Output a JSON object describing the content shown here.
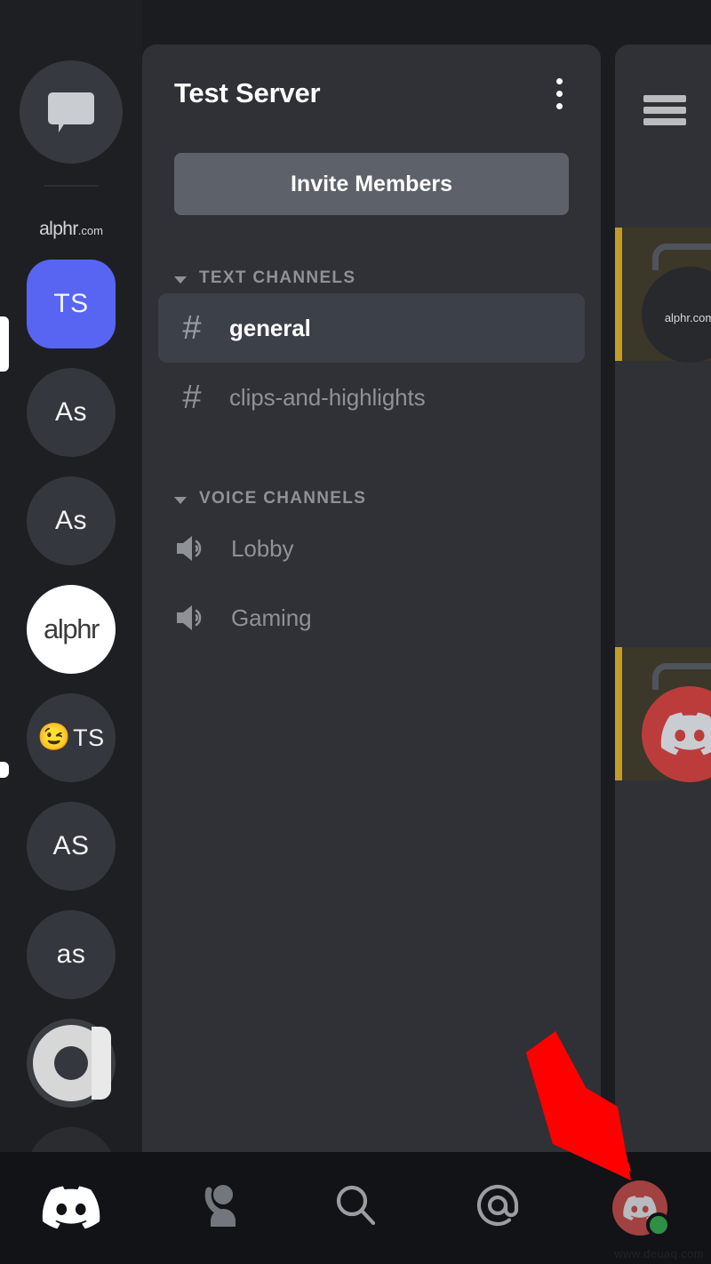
{
  "app": {
    "name": "Discord",
    "platform": "mobile"
  },
  "colors": {
    "brand": "#5865f2",
    "panel_bg": "#2f3136",
    "rail_bg": "#1d1f23",
    "nav_bg": "#121316",
    "channel_active_bg": "#3c4049",
    "invite_button_bg": "#5d6169",
    "mention_border": "#c49b2b",
    "annotation_arrow": "#ff0000",
    "status_online": "#2f8f45",
    "text_muted": "#8e9297",
    "text_primary": "#ffffff"
  },
  "rail": {
    "dm_icon": "chat-bubble-icon",
    "brand_watermark": {
      "text": "alphr",
      "suffix": ".com"
    },
    "servers": [
      {
        "id": "ts-selected",
        "label": "TS",
        "style": "selected",
        "selected": true,
        "unread": false
      },
      {
        "id": "as-1",
        "label": "As",
        "style": "circle",
        "selected": false,
        "unread": false
      },
      {
        "id": "as-2",
        "label": "As",
        "style": "circle",
        "selected": false,
        "unread": false
      },
      {
        "id": "alphr",
        "label": "alphr",
        "style": "white-logo",
        "selected": false,
        "unread": false
      },
      {
        "id": "emoji-ts",
        "label": "TS",
        "emoji": "😉",
        "style": "emoji",
        "selected": false,
        "unread": true
      },
      {
        "id": "as-3",
        "label": "AS",
        "style": "circle",
        "selected": false,
        "unread": false
      },
      {
        "id": "as-4",
        "label": "as",
        "style": "circle",
        "selected": false,
        "unread": false
      },
      {
        "id": "eye-logo",
        "label": "",
        "style": "eye-logo",
        "selected": false,
        "unread": false
      }
    ]
  },
  "panel": {
    "server_name": "Test Server",
    "overflow_menu_icon": "kebab-menu-icon",
    "invite_label": "Invite Members",
    "categories": [
      {
        "id": "text-channels",
        "label": "TEXT CHANNELS",
        "collapsed": false,
        "chevron_icon": "chevron-down-icon",
        "channels": [
          {
            "id": "general",
            "name": "general",
            "type": "text",
            "icon": "hash-icon",
            "active": true
          },
          {
            "id": "clips-and-highlights",
            "name": "clips-and-highlights",
            "type": "text",
            "icon": "hash-icon",
            "active": false
          }
        ]
      },
      {
        "id": "voice-channels",
        "label": "VOICE CHANNELS",
        "collapsed": false,
        "chevron_icon": "chevron-down-icon",
        "channels": [
          {
            "id": "lobby",
            "name": "Lobby",
            "type": "voice",
            "icon": "speaker-icon",
            "active": false
          },
          {
            "id": "gaming",
            "name": "Gaming",
            "type": "voice",
            "icon": "speaker-icon",
            "active": false
          }
        ]
      }
    ]
  },
  "right_panel": {
    "menu_icon": "hamburger-menu-icon",
    "messages": [
      {
        "id": "msg-1",
        "avatar": "alphr-avatar",
        "avatar_text": "alphr",
        "avatar_suffix": ".com",
        "mention": true,
        "reply": true
      },
      {
        "id": "msg-2",
        "avatar": "discord-avatar",
        "avatar_text": "",
        "mention": true,
        "reply": true
      }
    ]
  },
  "bottom_nav": {
    "items": [
      {
        "id": "servers",
        "icon": "discord-logo-icon",
        "active": true
      },
      {
        "id": "friends",
        "icon": "friends-wave-icon",
        "active": false
      },
      {
        "id": "search",
        "icon": "search-icon",
        "active": false
      },
      {
        "id": "mentions",
        "icon": "at-mention-icon",
        "active": false
      },
      {
        "id": "profile",
        "icon": "user-avatar-icon",
        "active": false,
        "status": "online"
      }
    ]
  },
  "annotation": {
    "type": "arrow",
    "icon": "red-arrow-annotation",
    "points_to": "profile",
    "color": "#ff0000"
  },
  "watermark": {
    "text": "www.deuaq.com"
  }
}
